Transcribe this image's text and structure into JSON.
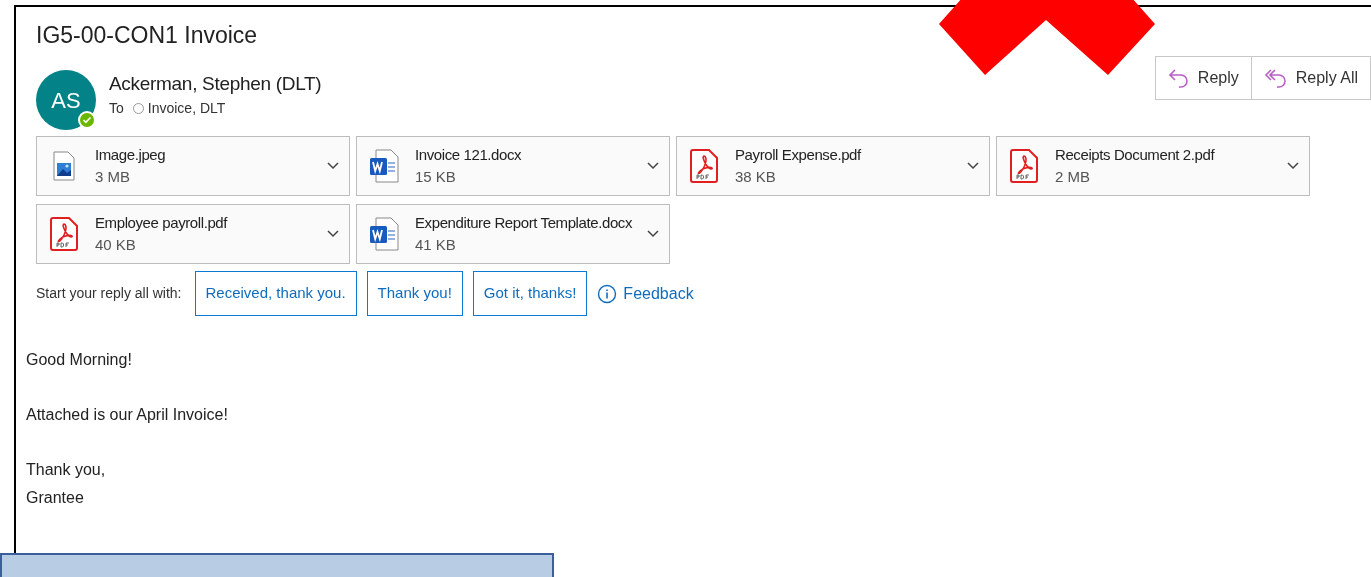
{
  "email": {
    "subject": "IG5-00-CON1 Invoice",
    "avatar_initials": "AS",
    "sender": "Ackerman, Stephen (DLT)",
    "to_label": "To",
    "recipient": "Invoice, DLT"
  },
  "actions": [
    {
      "kind": "reply",
      "label": "Reply"
    },
    {
      "kind": "reply_all",
      "label": "Reply All"
    }
  ],
  "attachments": [
    {
      "kind": "image",
      "name": "Image.jpeg",
      "size": "3 MB"
    },
    {
      "kind": "word",
      "name": "Invoice 121.docx",
      "size": "15 KB"
    },
    {
      "kind": "pdf",
      "name": "Payroll Expense.pdf",
      "size": "38 KB"
    },
    {
      "kind": "pdf",
      "name": "Receipts Document 2.pdf",
      "size": "2 MB"
    },
    {
      "kind": "pdf",
      "name": "Employee payroll.pdf",
      "size": "40 KB"
    },
    {
      "kind": "word",
      "name": "Expenditure Report Template.docx",
      "size": "41 KB"
    }
  ],
  "quick_replies": {
    "prompt": "Start your reply all with:",
    "options": [
      "Received, thank you.",
      "Thank you!",
      "Got it, thanks!"
    ],
    "feedback": "Feedback"
  },
  "body": [
    "Good Morning!",
    "Attached is our April Invoice!",
    "Thank you,\nGrantee"
  ]
}
